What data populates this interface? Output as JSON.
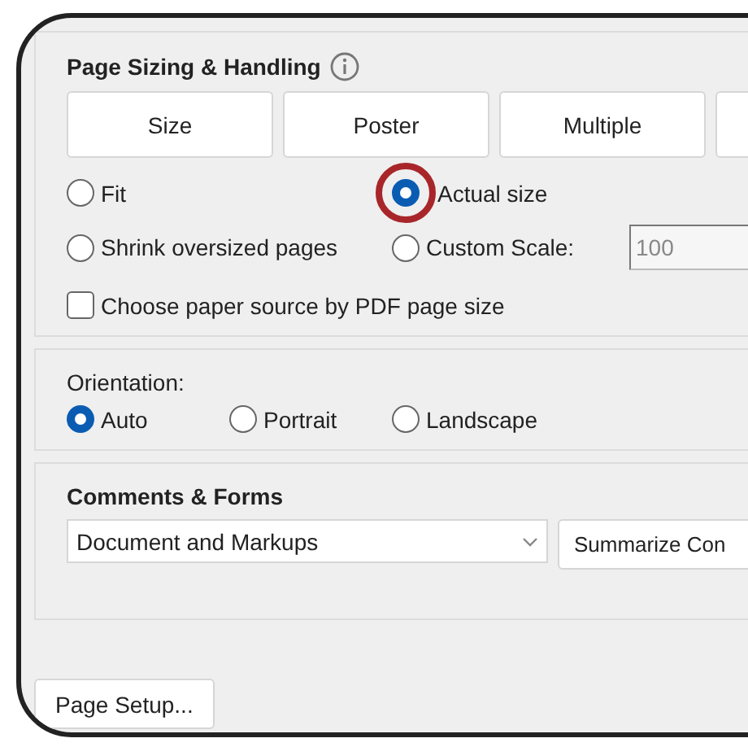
{
  "page_sizing": {
    "title": "Page Sizing & Handling",
    "tabs": [
      {
        "label": "Size"
      },
      {
        "label": "Poster"
      },
      {
        "label": "Multiple"
      }
    ],
    "scaling_options": [
      {
        "label": "Fit",
        "selected": false,
        "highlighted": false
      },
      {
        "label": "Actual size",
        "selected": true,
        "highlighted": true
      },
      {
        "label": "Shrink oversized pages",
        "selected": false,
        "highlighted": false
      },
      {
        "label": "Custom Scale:",
        "selected": false,
        "highlighted": false
      }
    ],
    "custom_scale": {
      "value": "100",
      "disabled": true
    },
    "paper_source": {
      "label": "Choose paper source by PDF page size",
      "checked": false
    }
  },
  "orientation": {
    "label": "Orientation:",
    "options": [
      {
        "label": "Auto",
        "selected": true
      },
      {
        "label": "Portrait",
        "selected": false
      },
      {
        "label": "Landscape",
        "selected": false
      }
    ]
  },
  "comments_forms": {
    "title": "Comments & Forms",
    "dropdown": {
      "value": "Document and Markups"
    },
    "button": "Summarize Con"
  },
  "page_setup_button": "Page Setup..."
}
